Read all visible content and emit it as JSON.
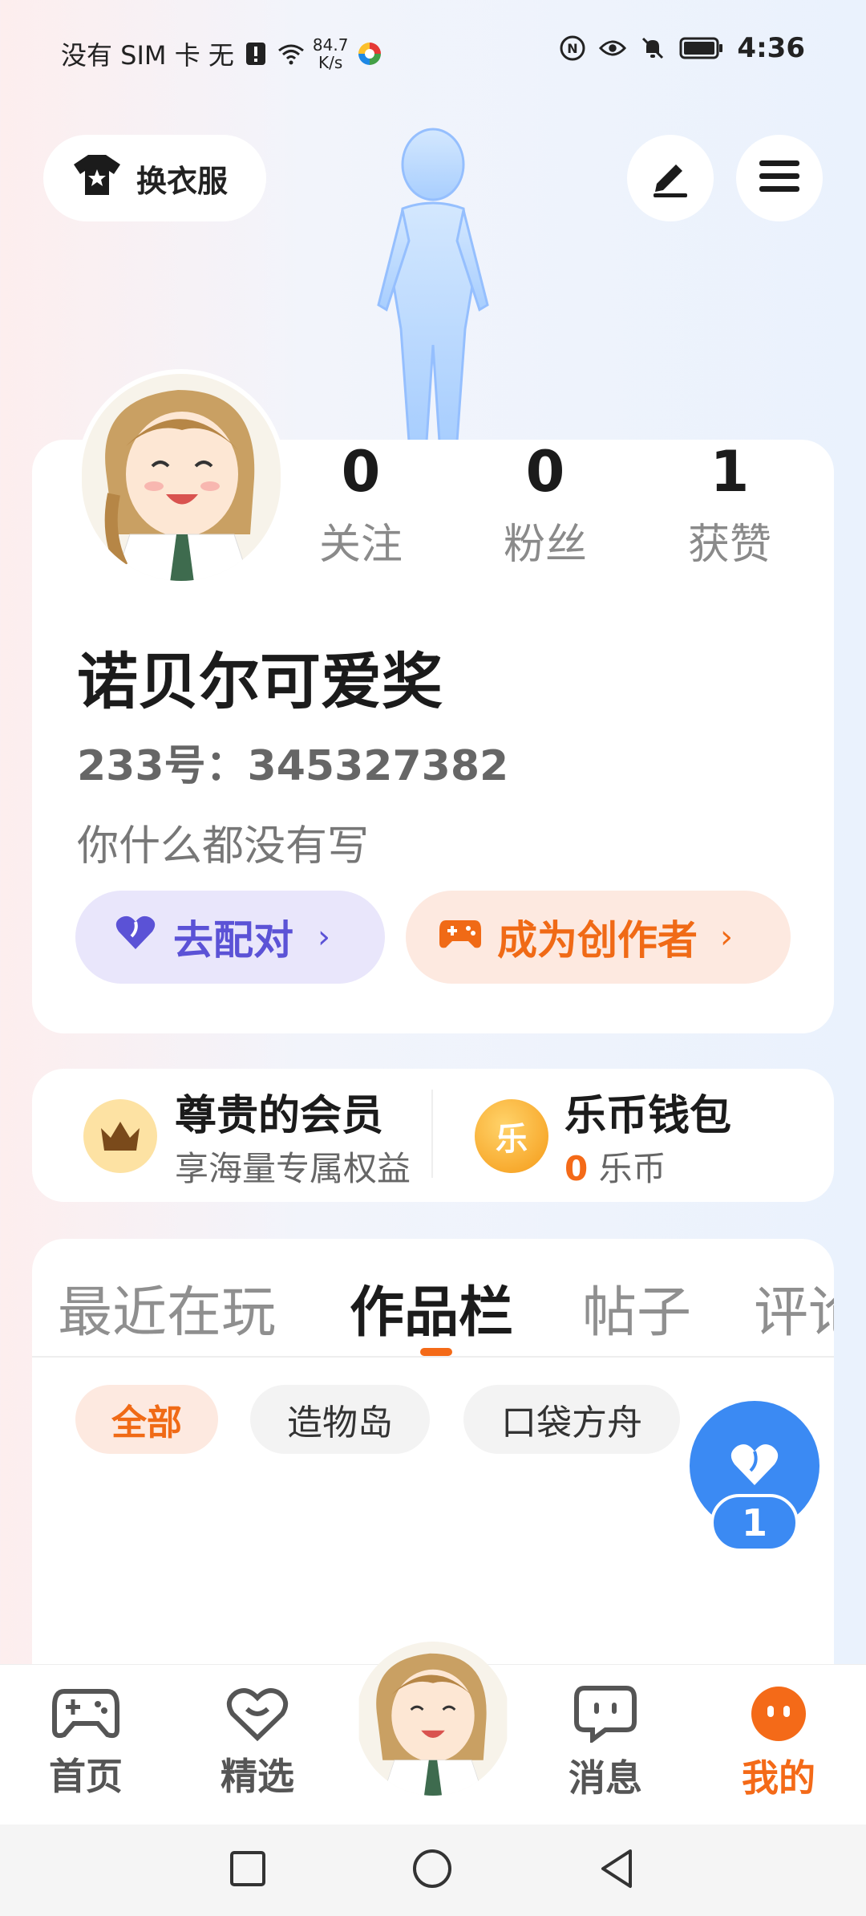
{
  "status_bar": {
    "carrier": "没有 SIM 卡 无",
    "net_speed_value": "84.7",
    "net_speed_unit": "K/s",
    "time": "4:36"
  },
  "top": {
    "outfit_label": "换衣服"
  },
  "profile": {
    "stats": [
      {
        "value": "0",
        "label": "关注"
      },
      {
        "value": "0",
        "label": "粉丝"
      },
      {
        "value": "1",
        "label": "获赞"
      }
    ],
    "name": "诺贝尔可爱奖",
    "id_line": "233号：345327382",
    "bio": "你什么都没有写",
    "match_label": "去配对",
    "creator_label": "成为创作者"
  },
  "perks": {
    "member_title": "尊贵的会员",
    "member_sub": "享海量专属权益",
    "wallet_title": "乐币钱包",
    "wallet_amount": "0",
    "wallet_unit": "乐币",
    "coin_glyph": "乐"
  },
  "tabs": [
    "最近在玩",
    "作品栏",
    "帖子",
    "评论"
  ],
  "active_tab": "作品栏",
  "chips": [
    "全部",
    "造物岛",
    "口袋方舟"
  ],
  "like_count": "1",
  "nav": {
    "home": "首页",
    "featured": "精选",
    "messages": "消息",
    "mine": "我的"
  },
  "colors": {
    "accent_orange": "#f46a18",
    "accent_purple": "#5b52d6",
    "fab_blue": "#3b8af3"
  }
}
